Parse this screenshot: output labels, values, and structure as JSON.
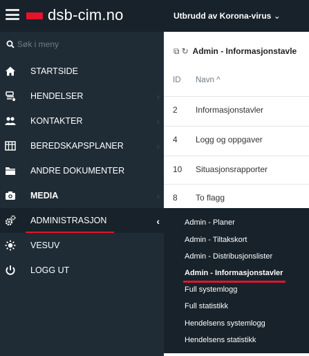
{
  "brand": {
    "name": "dsb-cim.no",
    "flag_color": "#e4142a"
  },
  "search": {
    "placeholder": "Søk i meny"
  },
  "menu": [
    {
      "label": "STARTSIDE",
      "icon": "home-icon",
      "chevron": false,
      "bold": false
    },
    {
      "label": "HENDELSER",
      "icon": "incidents-icon",
      "chevron": true,
      "bold": false
    },
    {
      "label": "KONTAKTER",
      "icon": "contacts-icon",
      "chevron": true,
      "bold": false
    },
    {
      "label": "BEREDSKAPSPLANER",
      "icon": "plans-icon",
      "chevron": true,
      "bold": false
    },
    {
      "label": "ANDRE DOKUMENTER",
      "icon": "folder-icon",
      "chevron": false,
      "bold": false
    },
    {
      "label": "MEDIA",
      "icon": "camera-icon",
      "chevron": true,
      "bold": true
    },
    {
      "label": "ADMINISTRASJON",
      "icon": "cogs-icon",
      "chevron": true,
      "bold": false,
      "active": true
    },
    {
      "label": "VESUV",
      "icon": "sun-icon",
      "chevron": false,
      "bold": false
    },
    {
      "label": "LOGG UT",
      "icon": "power-icon",
      "chevron": false,
      "bold": false
    }
  ],
  "topbar": {
    "incident_selector": "Utbrudd av Korona-virus"
  },
  "panel": {
    "title": "Admin - Informasjonstavle",
    "columns": {
      "id": "ID",
      "name": "Navn"
    },
    "rows": [
      {
        "id": "2",
        "name": "Informasjonstavler"
      },
      {
        "id": "4",
        "name": "Logg og oppgaver"
      },
      {
        "id": "10",
        "name": "Situasjonsrapporter"
      },
      {
        "id": "8",
        "name": "To flagg"
      }
    ]
  },
  "submenu": [
    {
      "label": "Admin - Planer",
      "bold": false
    },
    {
      "label": "Admin - Tiltakskort",
      "bold": false
    },
    {
      "label": "Admin - Distribusjonslister",
      "bold": false
    },
    {
      "label": "Admin - Informasjonstavler",
      "bold": true
    },
    {
      "label": "Full systemlogg",
      "bold": false
    },
    {
      "label": "Full statistikk",
      "bold": false
    },
    {
      "label": "Hendelsens systemlogg",
      "bold": false
    },
    {
      "label": "Hendelsens statistikk",
      "bold": false
    }
  ],
  "colors": {
    "sidebar_bg": "#1f2c36",
    "header_bg": "#17222a",
    "accent_red": "#e4142a"
  }
}
